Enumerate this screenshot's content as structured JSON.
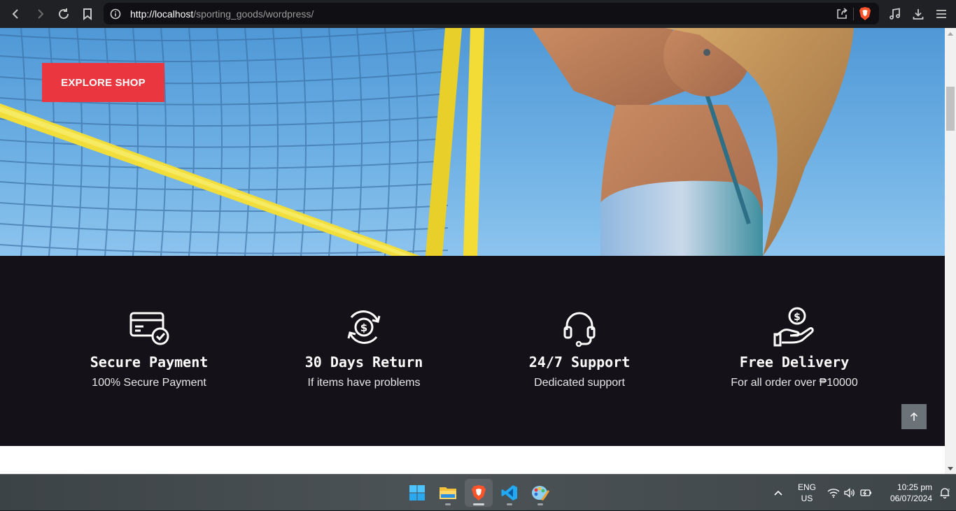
{
  "browser": {
    "url_host": "http://localhost",
    "url_path": "/sporting_goods/wordpress/"
  },
  "hero": {
    "cta_label": "EXPLORE SHOP",
    "cta_color": "#e9363f"
  },
  "features": [
    {
      "icon": "credit-card-check-icon",
      "title": "Secure Payment",
      "subtitle": "100% Secure Payment"
    },
    {
      "icon": "refresh-dollar-icon",
      "title": "30 Days Return",
      "subtitle": "If items have problems"
    },
    {
      "icon": "headset-icon",
      "title": "24/7 Support",
      "subtitle": "Dedicated support"
    },
    {
      "icon": "hand-coin-icon",
      "title": "Free Delivery",
      "subtitle": "For all order over ₱10000"
    }
  ],
  "taskbar": {
    "apps": [
      "windows-start-icon",
      "file-explorer-icon",
      "brave-browser-icon",
      "vscode-icon",
      "paint-icon"
    ],
    "language": "ENG",
    "region": "US",
    "time": "10:25 pm",
    "date": "06/07/2024"
  }
}
